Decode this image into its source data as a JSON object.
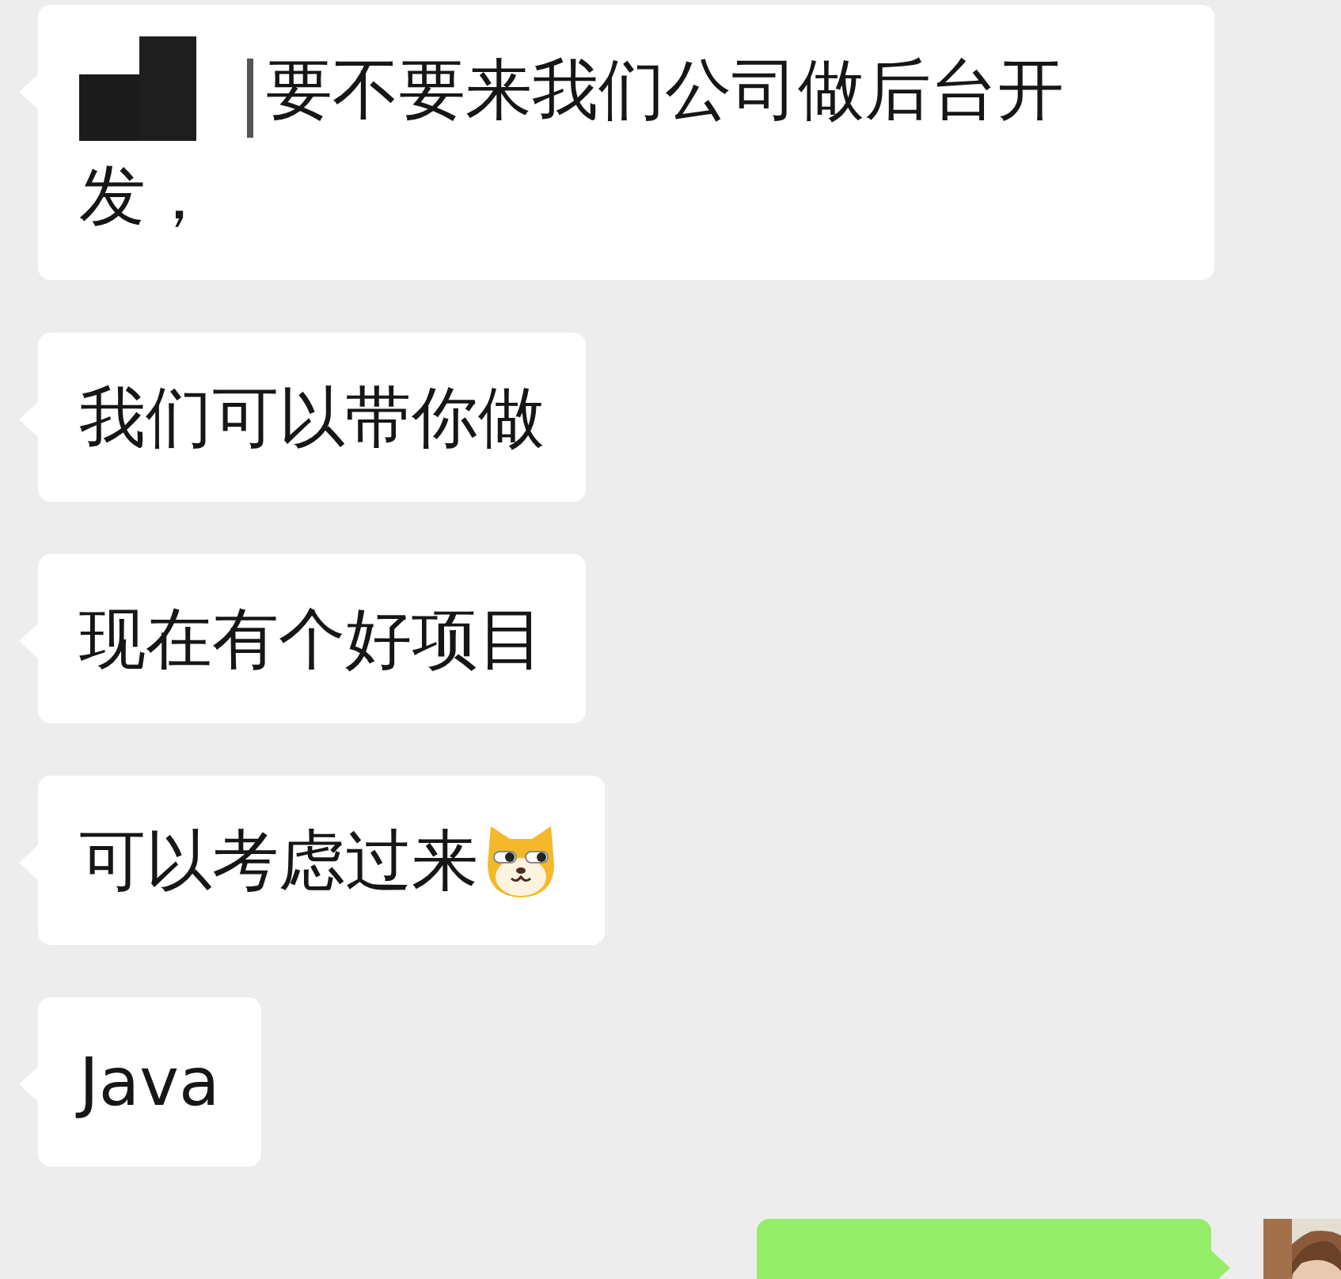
{
  "messages": [
    {
      "outgoing": false,
      "kind": "text",
      "redacted": true,
      "text": "要不要来我们公司做后台开发，"
    },
    {
      "outgoing": false,
      "kind": "text",
      "text": "我们可以带你做"
    },
    {
      "outgoing": false,
      "kind": "text",
      "text": "现在有个好项目"
    },
    {
      "outgoing": false,
      "kind": "text_with_emoji",
      "text": "可以考虑过来"
    },
    {
      "outgoing": false,
      "kind": "text",
      "text": "Java"
    },
    {
      "outgoing": true,
      "kind": "partial"
    }
  ]
}
